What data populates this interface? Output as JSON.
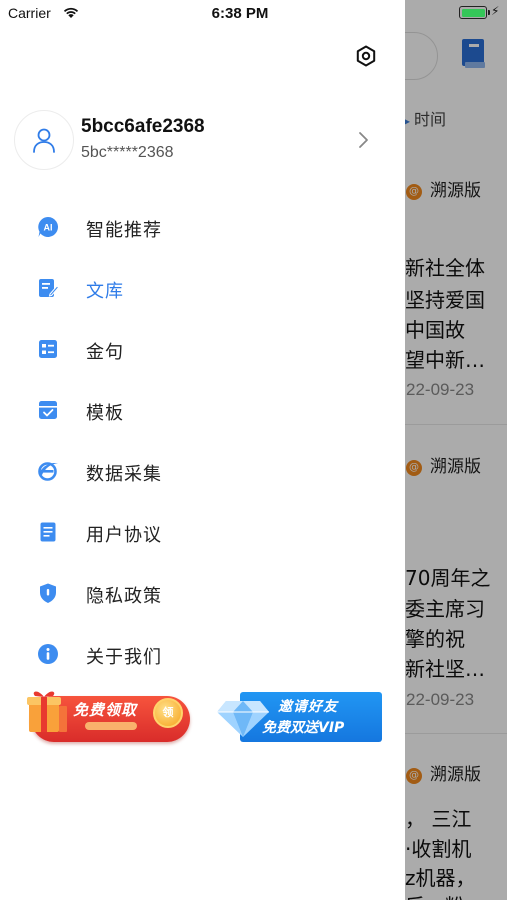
{
  "status_bar": {
    "carrier": "Carrier",
    "time": "6:38 PM"
  },
  "drawer": {
    "user": {
      "name": "5bcc6afe2368",
      "id": "5bc*****2368"
    },
    "menu": [
      {
        "label": "智能推荐",
        "icon": "ai-icon",
        "active": false
      },
      {
        "label": "文库",
        "icon": "library-edit-icon",
        "active": true
      },
      {
        "label": "金句",
        "icon": "quote-card-icon",
        "active": false
      },
      {
        "label": "模板",
        "icon": "template-icon",
        "active": false
      },
      {
        "label": "数据采集",
        "icon": "data-collect-icon",
        "active": false
      },
      {
        "label": "用户协议",
        "icon": "agreement-doc-icon",
        "active": false
      },
      {
        "label": "隐私政策",
        "icon": "privacy-shield-icon",
        "active": false
      },
      {
        "label": "关于我们",
        "icon": "info-icon",
        "active": false
      }
    ],
    "banners": {
      "free": {
        "title": "免费领取",
        "coin": "领"
      },
      "vip": {
        "line1": "邀请好友",
        "line2": "免费双送VIP"
      }
    }
  },
  "background_page": {
    "time_label": "时间",
    "articles": [
      {
        "source": "溯源版",
        "lines": [
          "新社全体",
          "坚持爱国",
          "中国故",
          "望中新…"
        ],
        "date": "22-09-23"
      },
      {
        "source": "溯源版",
        "lines": [
          "70周年之",
          "委主席习",
          "擎的祝",
          "新社坚…"
        ],
        "date": "22-09-23"
      },
      {
        "source": "溯源版",
        "lines": [
          "，  三江",
          "·收割机",
          "z机器，",
          "后，粉"
        ]
      }
    ]
  },
  "colors": {
    "accent": "#2f7ce8",
    "active_text": "#2f7ce8",
    "battery": "#35c759",
    "free_banner": "#e8392f",
    "vip_banner": "#1a86ea"
  }
}
